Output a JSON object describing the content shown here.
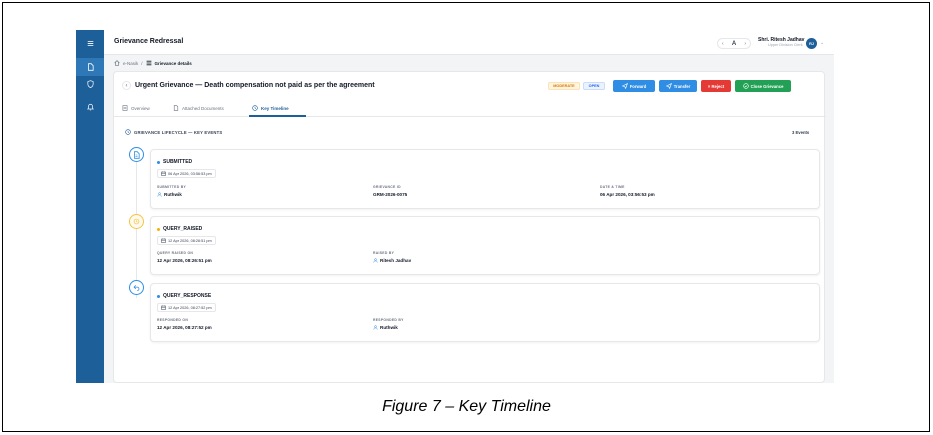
{
  "app": {
    "title": "Grievance Redressal",
    "zoom_label": "A",
    "zoom_decrease": "‹",
    "zoom_increase": "›"
  },
  "user": {
    "name": "Shri. Ritesh Jadhav",
    "role": "Upper Division Clerk",
    "initials": "RJ"
  },
  "breadcrumb": {
    "root": "e-Nasik",
    "separator": "/",
    "current": "Grievance details"
  },
  "grievance": {
    "title": "Urgent Grievance — Death compensation not paid as per the agreement",
    "priority_badge": "MODERATE",
    "status_badge": "OPEN"
  },
  "actions": {
    "forward": "Forward",
    "transfer": "Transfer",
    "reject": "× Reject",
    "close": "Close Grievance"
  },
  "tabs": [
    {
      "label": "Overview"
    },
    {
      "label": "Attached Documents"
    },
    {
      "label": "Key Timeline"
    }
  ],
  "timeline": {
    "heading": "GRIEVANCE LIFECYCLE — KEY EVENTS",
    "count_label": "3 Events",
    "events": [
      {
        "title": "SUBMITTED",
        "time": "06 Apr 2026, 03:56:53 pm",
        "fields": [
          {
            "label": "SUBMITTED BY",
            "value": "Ruthwik"
          },
          {
            "label": "GRIEVANCE ID",
            "value": "GRM-2026-0075"
          },
          {
            "label": "DATE & TIME",
            "value": "06 Apr 2026, 03:56:53 pm"
          }
        ]
      },
      {
        "title": "QUERY_RAISED",
        "time": "12 Apr 2026, 08:26:51 pm",
        "fields": [
          {
            "label": "QUERY RAISED ON",
            "value": "12 Apr 2026, 08:26:51 pm"
          },
          {
            "label": "RAISED BY",
            "value": "Ritesh Jadhav"
          }
        ]
      },
      {
        "title": "QUERY_RESPONSE",
        "time": "12 Apr 2026, 08:27:52 pm",
        "fields": [
          {
            "label": "RESPONDED ON",
            "value": "12 Apr 2026, 08:27:52 pm"
          },
          {
            "label": "RESPONDED BY",
            "value": "Ruthwik"
          }
        ]
      }
    ]
  },
  "caption": "Figure 7 – Key Timeline",
  "colors": {
    "rail": "#1d5f99",
    "primary": "#2f8de4",
    "reject": "#e53935",
    "close": "#21a056",
    "moderate": "#d97706"
  }
}
